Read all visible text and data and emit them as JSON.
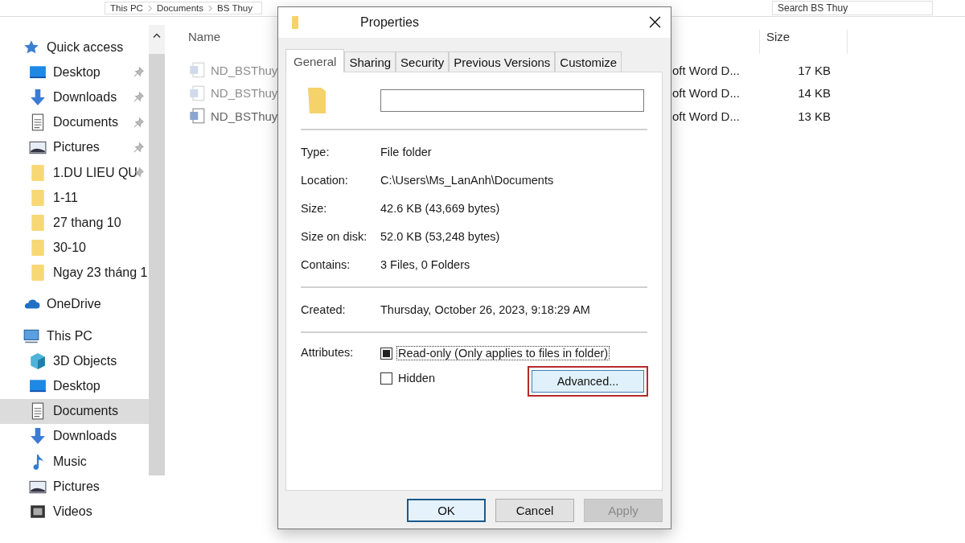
{
  "address_bar": {
    "path": [
      "This PC",
      "Documents",
      "BS Thuy"
    ],
    "search": {
      "placeholder": "Search BS Thuy"
    }
  },
  "sidebar": {
    "groups": [
      {
        "label": "Quick access",
        "kind": "star",
        "children": [
          {
            "label": "Desktop",
            "kind": "desktop",
            "pinned": true,
            "selected": false
          },
          {
            "label": "Downloads",
            "kind": "download",
            "pinned": true,
            "selected": false
          },
          {
            "label": "Documents",
            "kind": "document",
            "pinned": true,
            "selected": false
          },
          {
            "label": "Pictures",
            "kind": "picture",
            "pinned": true,
            "selected": false
          },
          {
            "label": "1.DU LIEU QU",
            "kind": "folder",
            "pinned": true,
            "selected": false
          },
          {
            "label": "1-11",
            "kind": "folder",
            "pinned": false,
            "selected": false
          },
          {
            "label": "27 thang 10",
            "kind": "folder",
            "pinned": false,
            "selected": false
          },
          {
            "label": "30-10",
            "kind": "folder",
            "pinned": false,
            "selected": false
          },
          {
            "label": "Ngay 23 tháng 1",
            "kind": "folder",
            "pinned": false,
            "selected": false
          }
        ]
      },
      {
        "label": "OneDrive",
        "kind": "cloud"
      },
      {
        "label": "This PC",
        "kind": "pc",
        "children": [
          {
            "label": "3D Objects",
            "kind": "cube",
            "pinned": false,
            "selected": false
          },
          {
            "label": "Desktop",
            "kind": "desktop",
            "pinned": false,
            "selected": false
          },
          {
            "label": "Documents",
            "kind": "document",
            "pinned": false,
            "selected": true
          },
          {
            "label": "Downloads",
            "kind": "download",
            "pinned": false,
            "selected": false
          },
          {
            "label": "Music",
            "kind": "music",
            "pinned": false,
            "selected": false
          },
          {
            "label": "Pictures",
            "kind": "picture",
            "pinned": false,
            "selected": false
          },
          {
            "label": "Videos",
            "kind": "video",
            "pinned": false,
            "selected": false
          }
        ]
      }
    ]
  },
  "file_list": {
    "columns": [
      "Name",
      "Size"
    ],
    "rows": [
      {
        "name": "ND_BSThuy",
        "type": "oft Word D...",
        "size": "17 KB",
        "dimmed": true
      },
      {
        "name": "ND_BSThuy",
        "type": "oft Word D...",
        "size": "14 KB",
        "dimmed": true
      },
      {
        "name": "ND_BSThuy",
        "type": "oft Word D...",
        "size": "13 KB",
        "dimmed": false
      }
    ]
  },
  "dialog": {
    "title": "Properties",
    "tabs": [
      {
        "label": "General",
        "selected": true
      },
      {
        "label": "Sharing",
        "selected": false
      },
      {
        "label": "Security",
        "selected": false
      },
      {
        "label": "Previous Versions",
        "selected": false
      },
      {
        "label": "Customize",
        "selected": false
      }
    ],
    "property_groups": [
      [
        {
          "label": "Type:",
          "value": "File folder"
        },
        {
          "label": "Location:",
          "value": "C:\\Users\\Ms_LanAnh\\Documents"
        },
        {
          "label": "Size:",
          "value": "42.6 KB (43,669 bytes)"
        },
        {
          "label": "Size on disk:",
          "value": "52.0 KB (53,248 bytes)"
        },
        {
          "label": "Contains:",
          "value": "3 Files, 0 Folders"
        }
      ],
      [
        {
          "label": "Created:",
          "value": "Thursday, October 26, 2023, 9:18:29 AM"
        }
      ]
    ],
    "attributes": {
      "label": "Attributes:",
      "options": [
        {
          "label": "Read-only (Only applies to files in folder)",
          "checked": true,
          "focused": true
        },
        {
          "label": "Hidden",
          "checked": false,
          "focused": false
        }
      ],
      "advanced_button": {
        "label": "Advanced...",
        "highlighted": true
      }
    },
    "buttons": [
      {
        "label": "OK",
        "default": true,
        "disabled": false
      },
      {
        "label": "Cancel",
        "default": false,
        "disabled": false
      },
      {
        "label": "Apply",
        "default": false,
        "disabled": true
      }
    ]
  }
}
